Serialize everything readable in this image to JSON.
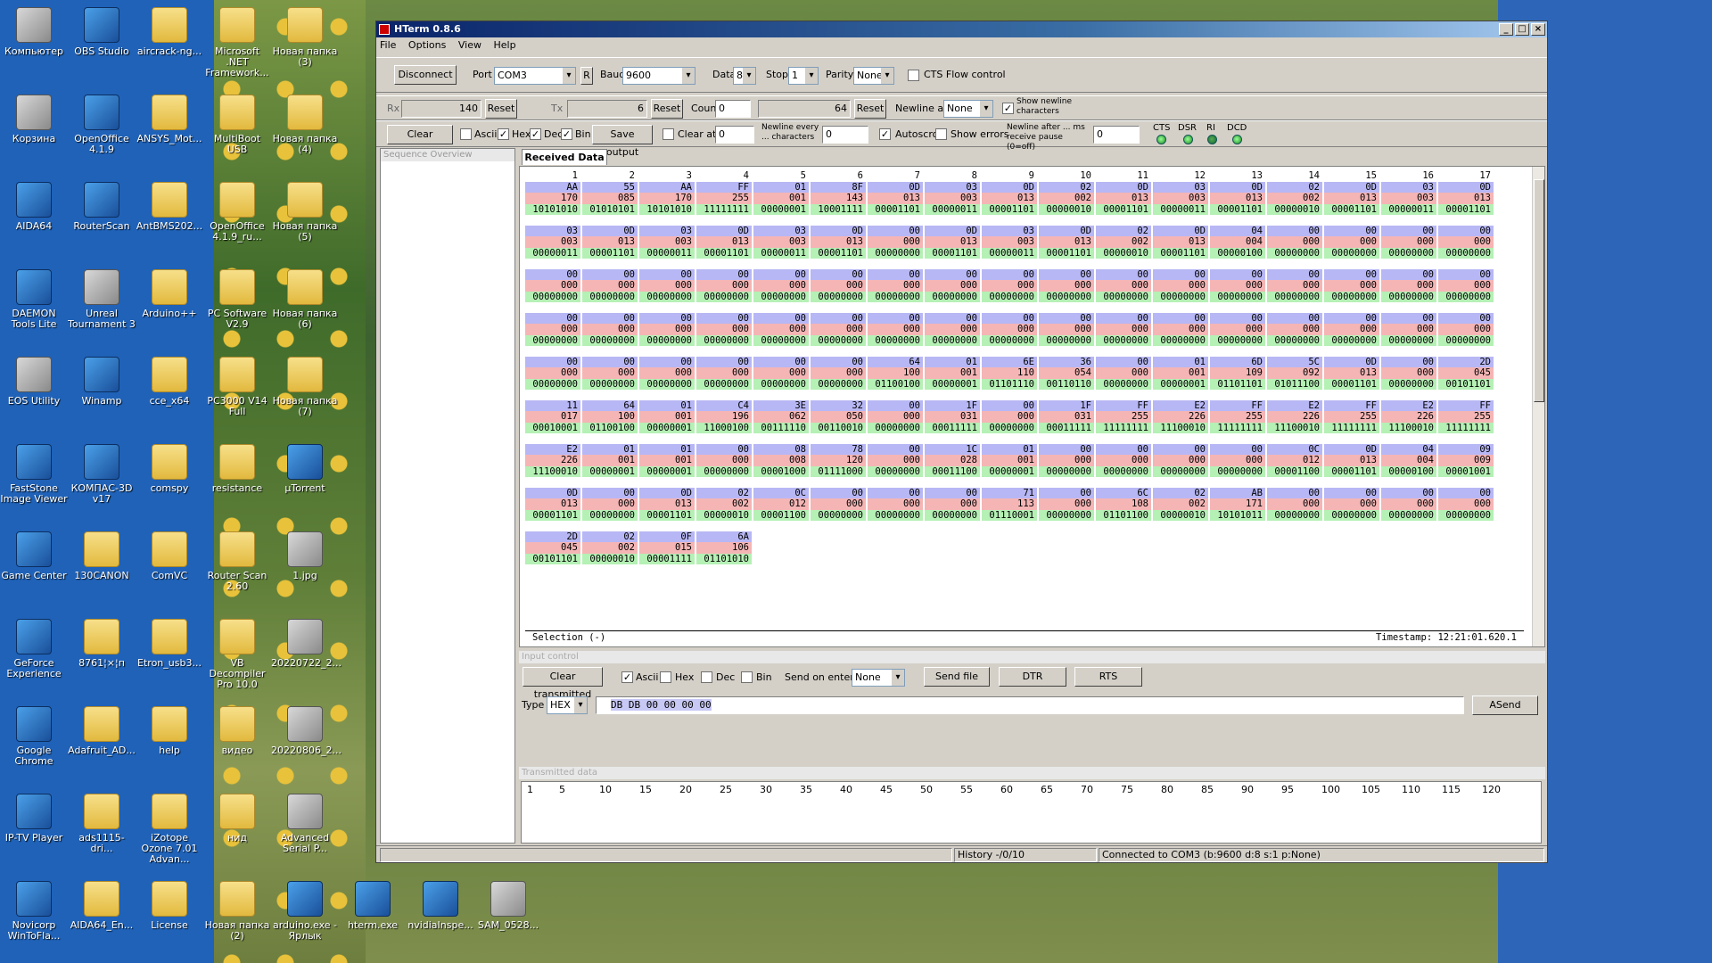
{
  "desktop": {
    "icons": [
      {
        "label": "Компьютер",
        "col": 0,
        "row": 0,
        "kind": "gray"
      },
      {
        "label": "OBS Studio",
        "col": 1,
        "row": 0,
        "kind": "app"
      },
      {
        "label": "aircrack-ng...",
        "col": 2,
        "row": 0,
        "kind": "fold"
      },
      {
        "label": "Microsoft .NET Framework...",
        "col": 3,
        "row": 0,
        "kind": "fold"
      },
      {
        "label": "Новая папка (3)",
        "col": 4,
        "row": 0,
        "kind": "fold"
      },
      {
        "label": "Корзина",
        "col": 0,
        "row": 1,
        "kind": "gray"
      },
      {
        "label": "OpenOffice 4.1.9",
        "col": 1,
        "row": 1,
        "kind": "app"
      },
      {
        "label": "ANSYS_Mot...",
        "col": 2,
        "row": 1,
        "kind": "fold"
      },
      {
        "label": "MultiBoot USB",
        "col": 3,
        "row": 1,
        "kind": "fold"
      },
      {
        "label": "Новая папка (4)",
        "col": 4,
        "row": 1,
        "kind": "fold"
      },
      {
        "label": "AIDA64",
        "col": 0,
        "row": 2,
        "kind": "app"
      },
      {
        "label": "RouterScan",
        "col": 1,
        "row": 2,
        "kind": "app"
      },
      {
        "label": "AntBMS202...",
        "col": 2,
        "row": 2,
        "kind": "fold"
      },
      {
        "label": "OpenOffice 4.1.9_ru...",
        "col": 3,
        "row": 2,
        "kind": "fold"
      },
      {
        "label": "Новая папка (5)",
        "col": 4,
        "row": 2,
        "kind": "fold"
      },
      {
        "label": "DAEMON Tools Lite",
        "col": 0,
        "row": 3,
        "kind": "app"
      },
      {
        "label": "Unreal Tournament 3",
        "col": 1,
        "row": 3,
        "kind": "gray"
      },
      {
        "label": "Arduino++",
        "col": 2,
        "row": 3,
        "kind": "fold"
      },
      {
        "label": "PC Software V2.9",
        "col": 3,
        "row": 3,
        "kind": "fold"
      },
      {
        "label": "Новая папка (6)",
        "col": 4,
        "row": 3,
        "kind": "fold"
      },
      {
        "label": "EOS Utility",
        "col": 0,
        "row": 4,
        "kind": "gray"
      },
      {
        "label": "Winamp",
        "col": 1,
        "row": 4,
        "kind": "app"
      },
      {
        "label": "cce_x64",
        "col": 2,
        "row": 4,
        "kind": "fold"
      },
      {
        "label": "PC3000 V14 Full",
        "col": 3,
        "row": 4,
        "kind": "fold"
      },
      {
        "label": "Новая папка (7)",
        "col": 4,
        "row": 4,
        "kind": "fold"
      },
      {
        "label": "FastStone Image Viewer",
        "col": 0,
        "row": 5,
        "kind": "app"
      },
      {
        "label": "КОМПАС-3D v17",
        "col": 1,
        "row": 5,
        "kind": "app"
      },
      {
        "label": "comspy",
        "col": 2,
        "row": 5,
        "kind": "fold"
      },
      {
        "label": "resistance",
        "col": 3,
        "row": 5,
        "kind": "fold"
      },
      {
        "label": "µTorrent",
        "col": 4,
        "row": 5,
        "kind": "app"
      },
      {
        "label": "Game Center",
        "col": 0,
        "row": 6,
        "kind": "app"
      },
      {
        "label": "130CANON",
        "col": 1,
        "row": 6,
        "kind": "fold"
      },
      {
        "label": "ComVC",
        "col": 2,
        "row": 6,
        "kind": "fold"
      },
      {
        "label": "Router Scan 2.60",
        "col": 3,
        "row": 6,
        "kind": "fold"
      },
      {
        "label": "1.jpg",
        "col": 4,
        "row": 6,
        "kind": "gray"
      },
      {
        "label": "GeForce Experience",
        "col": 0,
        "row": 7,
        "kind": "app"
      },
      {
        "label": "8761¦×¦п",
        "col": 1,
        "row": 7,
        "kind": "fold"
      },
      {
        "label": "Etron_usb3...",
        "col": 2,
        "row": 7,
        "kind": "fold"
      },
      {
        "label": "VB Decompiler Pro 10.0",
        "col": 3,
        "row": 7,
        "kind": "fold"
      },
      {
        "label": "20220722_2...",
        "col": 4,
        "row": 7,
        "kind": "gray"
      },
      {
        "label": "Google Chrome",
        "col": 0,
        "row": 8,
        "kind": "app"
      },
      {
        "label": "Adafruit_AD...",
        "col": 1,
        "row": 8,
        "kind": "fold"
      },
      {
        "label": "help",
        "col": 2,
        "row": 8,
        "kind": "fold"
      },
      {
        "label": "видео",
        "col": 3,
        "row": 8,
        "kind": "fold"
      },
      {
        "label": "20220806_2...",
        "col": 4,
        "row": 8,
        "kind": "gray"
      },
      {
        "label": "IP-TV Player",
        "col": 0,
        "row": 9,
        "kind": "app"
      },
      {
        "label": "ads1115-dri...",
        "col": 1,
        "row": 9,
        "kind": "fold"
      },
      {
        "label": "iZotope Ozone 7.01 Advan...",
        "col": 2,
        "row": 9,
        "kind": "fold"
      },
      {
        "label": "нид",
        "col": 3,
        "row": 9,
        "kind": "fold"
      },
      {
        "label": "Advanced Serial P...",
        "col": 4,
        "row": 9,
        "kind": "gray"
      },
      {
        "label": "Novicorp WinToFla...",
        "col": 0,
        "row": 10,
        "kind": "app"
      },
      {
        "label": "AIDA64_En...",
        "col": 1,
        "row": 10,
        "kind": "fold"
      },
      {
        "label": "License",
        "col": 2,
        "row": 10,
        "kind": "fold"
      },
      {
        "label": "Новая папка (2)",
        "col": 3,
        "row": 10,
        "kind": "fold"
      },
      {
        "label": "arduino.exe - Ярлык",
        "col": 4,
        "row": 10,
        "kind": "app"
      },
      {
        "label": "hterm.exe",
        "col": 5,
        "row": 10,
        "kind": "app"
      },
      {
        "label": "nvidiaInspe...",
        "col": 6,
        "row": 10,
        "kind": "app"
      },
      {
        "label": "SAM_0528...",
        "col": 7,
        "row": 10,
        "kind": "gray"
      }
    ]
  },
  "window": {
    "title": "HTerm 0.8.6",
    "min": "_",
    "max": "□",
    "close": "×"
  },
  "menu": [
    "File",
    "Options",
    "View",
    "Help"
  ],
  "connbar": {
    "disconnect": "Disconnect",
    "port_label": "Port",
    "port": "COM3",
    "r": "R",
    "baud_label": "Baud",
    "baud": "9600",
    "data_label": "Data",
    "data": "8",
    "stop_label": "Stop",
    "stop": "1",
    "parity_label": "Parity",
    "parity": "None",
    "cts": "CTS Flow control"
  },
  "counters": {
    "rx_label": "Rx",
    "rx": "140",
    "tx_label": "Tx",
    "tx": "6",
    "reset": "Reset",
    "count_label": "Count",
    "count": "0",
    "count_val": "64",
    "newline_label": "Newline at",
    "newline": "None",
    "show_newline": "Show newline characters"
  },
  "options": {
    "clear_received": "Clear received",
    "ascii": "Ascii",
    "hex": "Hex",
    "dec": "Dec",
    "bin": "Bin",
    "save_output": "Save output",
    "clear_at": "Clear at",
    "clear_at_val": "0",
    "newline_every": "Newline every ... characters",
    "newline_every_val": "0",
    "autoscroll": "Autoscroll",
    "show_errors": "Show errors",
    "newline_after": "Newline after ... ms receive pause (0=off)",
    "newline_after_val": "0",
    "cts": "CTS",
    "dsr": "DSR",
    "ri": "RI",
    "dcd": "DCD"
  },
  "sequence_overview": "Sequence Overview",
  "received_tab": "Received Data",
  "columns": [
    "1",
    "2",
    "3",
    "4",
    "5",
    "6",
    "7",
    "8",
    "9",
    "10",
    "11",
    "12",
    "13",
    "14",
    "15",
    "16",
    "17"
  ],
  "blocks": [
    {
      "hex": [
        "AA",
        "55",
        "AA",
        "FF",
        "01",
        "8F",
        "0D",
        "03",
        "0D",
        "02",
        "0D",
        "03",
        "0D",
        "02",
        "0D",
        "03",
        "0D"
      ],
      "dec": [
        "170",
        "085",
        "170",
        "255",
        "001",
        "143",
        "013",
        "003",
        "013",
        "002",
        "013",
        "003",
        "013",
        "002",
        "013",
        "003",
        "013"
      ],
      "bin": [
        "10101010",
        "01010101",
        "10101010",
        "11111111",
        "00000001",
        "10001111",
        "00001101",
        "00000011",
        "00001101",
        "00000010",
        "00001101",
        "00000011",
        "00001101",
        "00000010",
        "00001101",
        "00000011",
        "00001101"
      ]
    },
    {
      "hex": [
        "03",
        "0D",
        "03",
        "0D",
        "03",
        "0D",
        "00",
        "0D",
        "03",
        "0D",
        "02",
        "0D",
        "04",
        "00",
        "00",
        "00",
        "00"
      ],
      "dec": [
        "003",
        "013",
        "003",
        "013",
        "003",
        "013",
        "000",
        "013",
        "003",
        "013",
        "002",
        "013",
        "004",
        "000",
        "000",
        "000",
        "000"
      ],
      "bin": [
        "00000011",
        "00001101",
        "00000011",
        "00001101",
        "00000011",
        "00001101",
        "00000000",
        "00001101",
        "00000011",
        "00001101",
        "00000010",
        "00001101",
        "00000100",
        "00000000",
        "00000000",
        "00000000",
        "00000000"
      ]
    },
    {
      "hex": [
        "00",
        "00",
        "00",
        "00",
        "00",
        "00",
        "00",
        "00",
        "00",
        "00",
        "00",
        "00",
        "00",
        "00",
        "00",
        "00",
        "00"
      ],
      "dec": [
        "000",
        "000",
        "000",
        "000",
        "000",
        "000",
        "000",
        "000",
        "000",
        "000",
        "000",
        "000",
        "000",
        "000",
        "000",
        "000",
        "000"
      ],
      "bin": [
        "00000000",
        "00000000",
        "00000000",
        "00000000",
        "00000000",
        "00000000",
        "00000000",
        "00000000",
        "00000000",
        "00000000",
        "00000000",
        "00000000",
        "00000000",
        "00000000",
        "00000000",
        "00000000",
        "00000000"
      ]
    },
    {
      "hex": [
        "00",
        "00",
        "00",
        "00",
        "00",
        "00",
        "00",
        "00",
        "00",
        "00",
        "00",
        "00",
        "00",
        "00",
        "00",
        "00",
        "00"
      ],
      "dec": [
        "000",
        "000",
        "000",
        "000",
        "000",
        "000",
        "000",
        "000",
        "000",
        "000",
        "000",
        "000",
        "000",
        "000",
        "000",
        "000",
        "000"
      ],
      "bin": [
        "00000000",
        "00000000",
        "00000000",
        "00000000",
        "00000000",
        "00000000",
        "00000000",
        "00000000",
        "00000000",
        "00000000",
        "00000000",
        "00000000",
        "00000000",
        "00000000",
        "00000000",
        "00000000",
        "00000000"
      ]
    },
    {
      "hex": [
        "00",
        "00",
        "00",
        "00",
        "00",
        "00",
        "64",
        "01",
        "6E",
        "36",
        "00",
        "01",
        "6D",
        "5C",
        "0D",
        "00",
        "2D"
      ],
      "dec": [
        "000",
        "000",
        "000",
        "000",
        "000",
        "000",
        "100",
        "001",
        "110",
        "054",
        "000",
        "001",
        "109",
        "092",
        "013",
        "000",
        "045"
      ],
      "bin": [
        "00000000",
        "00000000",
        "00000000",
        "00000000",
        "00000000",
        "00000000",
        "01100100",
        "00000001",
        "01101110",
        "00110110",
        "00000000",
        "00000001",
        "01101101",
        "01011100",
        "00001101",
        "00000000",
        "00101101"
      ]
    },
    {
      "hex": [
        "11",
        "64",
        "01",
        "C4",
        "3E",
        "32",
        "00",
        "1F",
        "00",
        "1F",
        "FF",
        "E2",
        "FF",
        "E2",
        "FF",
        "E2",
        "FF"
      ],
      "dec": [
        "017",
        "100",
        "001",
        "196",
        "062",
        "050",
        "000",
        "031",
        "000",
        "031",
        "255",
        "226",
        "255",
        "226",
        "255",
        "226",
        "255"
      ],
      "bin": [
        "00010001",
        "01100100",
        "00000001",
        "11000100",
        "00111110",
        "00110010",
        "00000000",
        "00011111",
        "00000000",
        "00011111",
        "11111111",
        "11100010",
        "11111111",
        "11100010",
        "11111111",
        "11100010",
        "11111111"
      ]
    },
    {
      "hex": [
        "E2",
        "01",
        "01",
        "00",
        "08",
        "78",
        "00",
        "1C",
        "01",
        "00",
        "00",
        "00",
        "00",
        "0C",
        "0D",
        "04",
        "09"
      ],
      "dec": [
        "226",
        "001",
        "001",
        "000",
        "008",
        "120",
        "000",
        "028",
        "001",
        "000",
        "000",
        "000",
        "000",
        "012",
        "013",
        "004",
        "009"
      ],
      "bin": [
        "11100010",
        "00000001",
        "00000001",
        "00000000",
        "00001000",
        "01111000",
        "00000000",
        "00011100",
        "00000001",
        "00000000",
        "00000000",
        "00000000",
        "00000000",
        "00001100",
        "00001101",
        "00000100",
        "00001001"
      ]
    },
    {
      "hex": [
        "0D",
        "00",
        "0D",
        "02",
        "0C",
        "00",
        "00",
        "00",
        "71",
        "00",
        "6C",
        "02",
        "AB",
        "00",
        "00",
        "00",
        "00"
      ],
      "dec": [
        "013",
        "000",
        "013",
        "002",
        "012",
        "000",
        "000",
        "000",
        "113",
        "000",
        "108",
        "002",
        "171",
        "000",
        "000",
        "000",
        "000"
      ],
      "bin": [
        "00001101",
        "00000000",
        "00001101",
        "00000010",
        "00001100",
        "00000000",
        "00000000",
        "00000000",
        "01110001",
        "00000000",
        "01101100",
        "00000010",
        "10101011",
        "00000000",
        "00000000",
        "00000000",
        "00000000"
      ]
    },
    {
      "hex": [
        "2D",
        "02",
        "0F",
        "6A"
      ],
      "dec": [
        "045",
        "002",
        "015",
        "106"
      ],
      "bin": [
        "00101101",
        "00000010",
        "00001111",
        "01101010"
      ]
    }
  ],
  "rx_status": {
    "selection": "Selection (-)",
    "timestamp": "Timestamp: 12:21:01.620.1"
  },
  "input_control": {
    "header": "Input control",
    "clear_transmitted": "Clear transmitted",
    "ascii": "Ascii",
    "hex": "Hex",
    "dec": "Dec",
    "bin": "Bin",
    "send_on_enter": "Send on enter",
    "send_on_enter_val": "None",
    "send_file": "Send file",
    "dtr": "DTR",
    "rts": "RTS",
    "type_label": "Type",
    "type_val": "HEX",
    "input": "DB DB 00 00 00 00",
    "asend": "ASend"
  },
  "transmitted": {
    "header": "Transmitted data",
    "ticks": [
      "1",
      "5",
      "10",
      "15",
      "20",
      "25",
      "30",
      "35",
      "40",
      "45",
      "50",
      "55",
      "60",
      "65",
      "70",
      "75",
      "80",
      "85",
      "90",
      "95",
      "100",
      "105",
      "110",
      "115",
      "120"
    ]
  },
  "status": {
    "history": "History -/0/10",
    "connected": "Connected to COM3 (b:9600 d:8 s:1 p:None)"
  }
}
